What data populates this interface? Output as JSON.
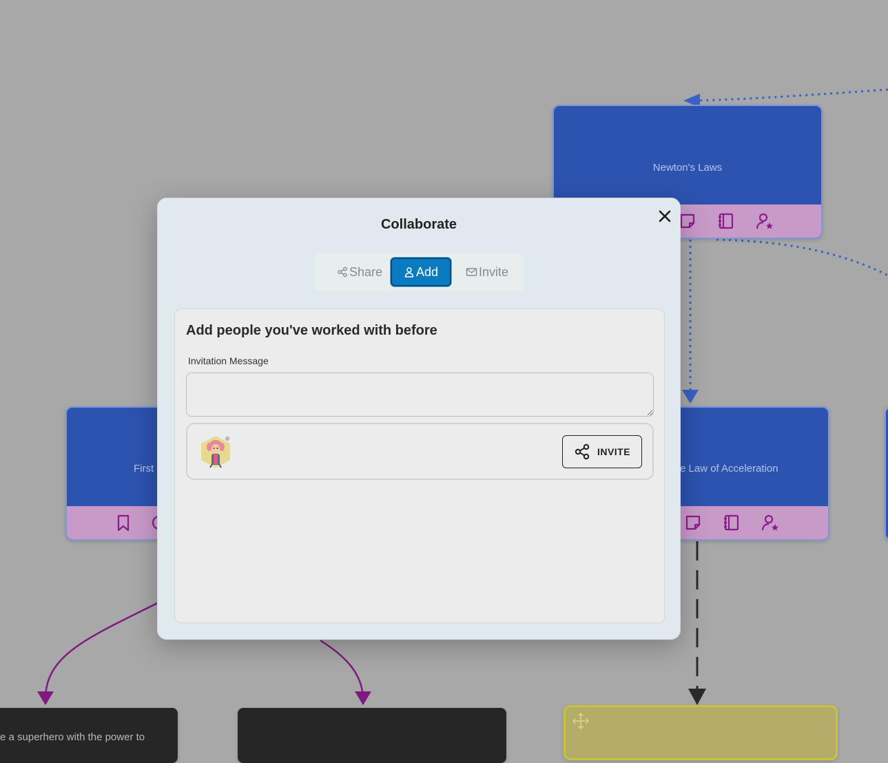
{
  "canvas": {
    "nodes": {
      "newtons_laws": {
        "label": "Newton's Laws"
      },
      "first_law": {
        "label": "First"
      },
      "law_of_acceleration": {
        "label": "e Law of Acceleration"
      },
      "superhero_snippet": {
        "text": "e a superhero with the power to"
      }
    },
    "colors": {
      "node_blue": "#2d53b0",
      "node_footer": "#c89ac8",
      "footer_icon": "#8b1a8b",
      "edge_blue": "#3a62c4",
      "edge_purple": "#80187f",
      "yellow_node": "#b4ad6a"
    }
  },
  "modal": {
    "title": "Collaborate",
    "tabs": [
      {
        "label": "Share",
        "icon": "share-icon",
        "active": false
      },
      {
        "label": "Add",
        "icon": "user-icon",
        "active": true
      },
      {
        "label": "Invite",
        "icon": "mail-icon",
        "active": false
      }
    ],
    "panel": {
      "heading": "Add people you've worked with before",
      "message_label": "Invitation Message",
      "message_value": "",
      "invite_button_label": "INVITE"
    }
  }
}
